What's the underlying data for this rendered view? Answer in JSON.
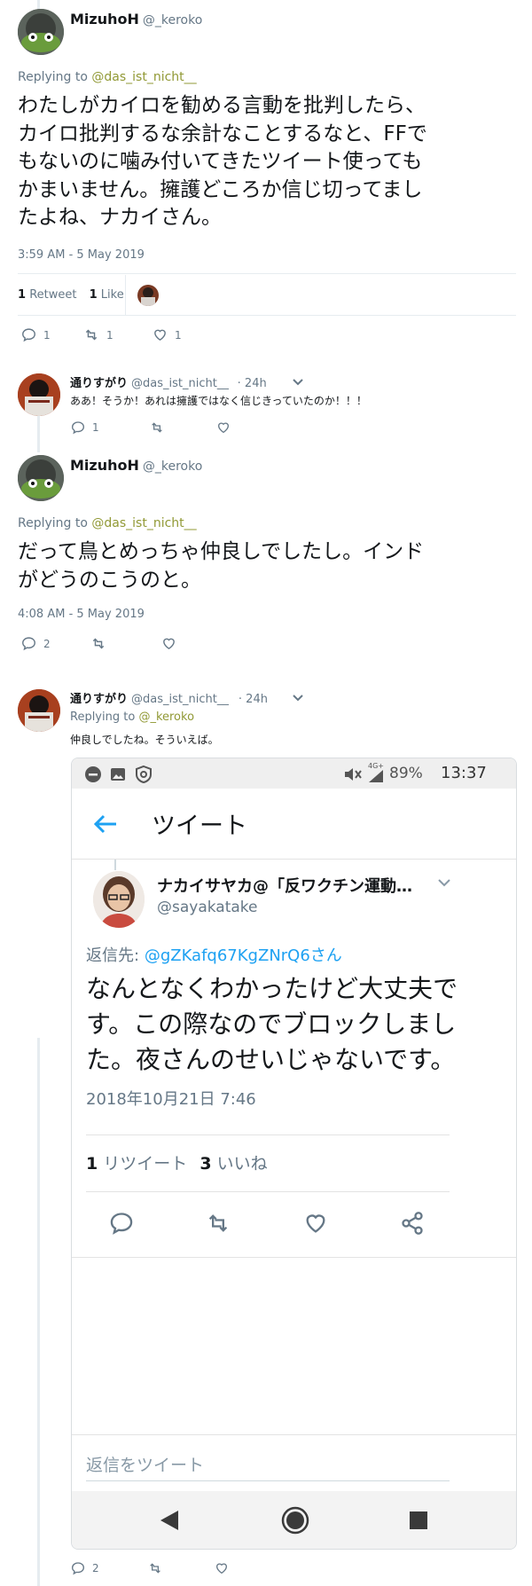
{
  "tweets": [
    {
      "name": "MizuhoH",
      "handle": "@_keroko",
      "replying_label": "Replying to",
      "replying_to": "@das_ist_nicht__",
      "text_lines": [
        "わたしがカイロを勧める言動を批判したら、",
        "カイロ批判するな余計なことするなと、FFで",
        "もないのに噛み付いてきたツイート使っても",
        "かまいません。擁護どころか信じ切ってまし",
        "たよね、ナカイさん。"
      ],
      "timestamp": "3:59 AM - 5 May 2019",
      "retweets_count": "1",
      "retweets_label": "Retweet",
      "likes_count": "1",
      "likes_label": "Like",
      "reply_count": "1",
      "retweet_count": "1",
      "like_count": "1"
    },
    {
      "name": "通りすがり",
      "handle": "@das_ist_nicht__",
      "time": "· 24h",
      "text": "ああ！そうか！あれは擁護ではなく信じきっていたのか！！！",
      "reply_count": "1"
    },
    {
      "name": "MizuhoH",
      "handle": "@_keroko",
      "replying_label": "Replying to",
      "replying_to": "@das_ist_nicht__",
      "text_lines": [
        "だって鳥とめっちゃ仲良しでしたし。インド",
        "がどうのこうのと。"
      ],
      "timestamp": "4:08 AM - 5 May 2019",
      "reply_count": "2"
    },
    {
      "name": "通りすがり",
      "handle": "@das_ist_nicht__",
      "time": "· 24h",
      "replying_label": "Replying to",
      "replying_to": "@_keroko",
      "text": "仲良しでしたね。そういえば。",
      "reply_count": "2"
    }
  ],
  "phone": {
    "status": {
      "battery": "89%",
      "clock": "13:37",
      "network": "4G+"
    },
    "appbar_title": "ツイート",
    "embedded": {
      "name": "ナカイサヤカ@「反ワクチン運動…",
      "handle": "@sayakatake",
      "reply_prefix": "返信先:",
      "reply_target": "@gZKafq67KgZNrQ6さん",
      "text_lines": [
        "なんとなくわかったけど大丈夫で",
        "す。この際なのでブロックしまし",
        "た。夜さんのせいじゃないです。"
      ],
      "timestamp": "2018年10月21日 7:46",
      "retweet_count": "1",
      "retweet_label": "リツイート",
      "like_count": "3",
      "like_label": "いいね"
    },
    "reply_placeholder": "返信をツイート"
  },
  "colors": {
    "accent": "#1da1f2",
    "muted": "#657786",
    "link_olive": "#919935"
  }
}
